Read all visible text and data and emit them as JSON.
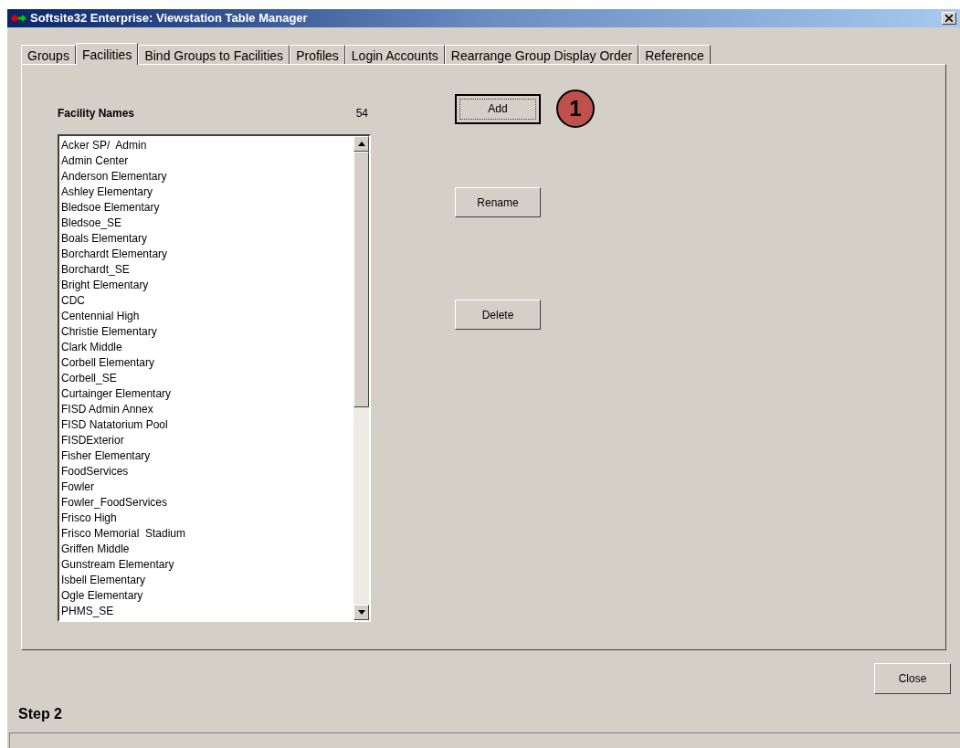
{
  "window": {
    "title": "Softsite32 Enterprise: Viewstation Table Manager"
  },
  "tabs": [
    {
      "label": "Groups",
      "selected": false
    },
    {
      "label": "Facilities",
      "selected": true
    },
    {
      "label": "Bind Groups to Facilities",
      "selected": false
    },
    {
      "label": "Profiles",
      "selected": false
    },
    {
      "label": "Login Accounts",
      "selected": false
    },
    {
      "label": "Rearrange Group Display Order",
      "selected": false
    },
    {
      "label": "Reference",
      "selected": false
    }
  ],
  "facility_list": {
    "heading": "Facility Names",
    "count": "54",
    "items": [
      "Acker SP/  Admin",
      "Admin Center",
      "Anderson Elementary",
      "Ashley Elementary",
      "Bledsoe Elementary",
      "Bledsoe_SE",
      "Boals Elementary",
      "Borchardt Elementary",
      "Borchardt_SE",
      "Bright Elementary",
      "CDC",
      "Centennial High",
      "Christie Elementary",
      "Clark Middle",
      "Corbell Elementary",
      "Corbell_SE",
      "Curtainger Elementary",
      "FISD Admin Annex",
      "FISD Natatorium Pool",
      "FISDExterior",
      "Fisher Elementary",
      "FoodServices",
      "Fowler",
      "Fowler_FoodServices",
      "Frisco High",
      "Frisco Memorial  Stadium",
      "Griffen Middle",
      "Gunstream Elementary",
      "Isbell Elementary",
      "Ogle Elementary",
      "PHMS_SE"
    ]
  },
  "buttons": [
    {
      "label": "Add",
      "focused": true
    },
    {
      "label": "Rename",
      "focused": false
    },
    {
      "label": "Delete",
      "focused": false
    }
  ],
  "callout": "1",
  "close_button": "Close",
  "step_label": "Step 2"
}
